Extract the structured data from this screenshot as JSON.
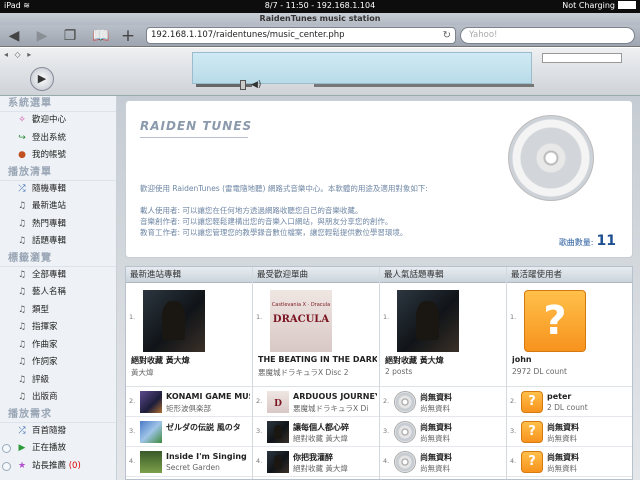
{
  "status_bar": {
    "device": "iPad",
    "wifi": "wifi-icon",
    "center": "8/7 - 11:50 - 192.168.1.104",
    "battery": "Not Charging"
  },
  "browser": {
    "title": "RaidenTunes music station",
    "url": "192.168.1.107/raidentunes/music_center.php",
    "search_placeholder": "Yahoo!"
  },
  "sidebar": {
    "sections": [
      {
        "heading": "系統選單",
        "items": [
          {
            "icon": "help-icon",
            "glyph": "✧",
            "color": "#d040a0",
            "label": "歡迎中心"
          },
          {
            "icon": "logout-icon",
            "glyph": "↪",
            "color": "#2a8a3a",
            "label": "登出系統"
          },
          {
            "icon": "account-icon",
            "glyph": "●",
            "color": "#c05020",
            "label": "我的帳號"
          }
        ]
      },
      {
        "heading": "播放清單",
        "items": [
          {
            "icon": "shuffle-icon",
            "glyph": "⤮",
            "color": "#3366aa",
            "label": "隨機專輯"
          },
          {
            "icon": "music-note-icon",
            "glyph": "♫",
            "color": "#555",
            "label": "最新進站"
          },
          {
            "icon": "music-note-icon",
            "glyph": "♫",
            "color": "#555",
            "label": "熱門專輯"
          },
          {
            "icon": "music-note-icon",
            "glyph": "♫",
            "color": "#555",
            "label": "話題專輯"
          }
        ]
      },
      {
        "heading": "標籤瀏覽",
        "items": [
          {
            "icon": "music-note-icon",
            "glyph": "♫",
            "color": "#555",
            "label": "全部專輯"
          },
          {
            "icon": "music-note-icon",
            "glyph": "♫",
            "color": "#555",
            "label": "藝人名稱"
          },
          {
            "icon": "music-note-icon",
            "glyph": "♫",
            "color": "#555",
            "label": "類型"
          },
          {
            "icon": "music-note-icon",
            "glyph": "♫",
            "color": "#555",
            "label": "指揮家"
          },
          {
            "icon": "music-note-icon",
            "glyph": "♫",
            "color": "#555",
            "label": "作曲家"
          },
          {
            "icon": "music-note-icon",
            "glyph": "♫",
            "color": "#555",
            "label": "作詞家"
          },
          {
            "icon": "music-note-icon",
            "glyph": "♫",
            "color": "#555",
            "label": "評級"
          },
          {
            "icon": "music-note-icon",
            "glyph": "♫",
            "color": "#555",
            "label": "出版商"
          }
        ]
      },
      {
        "heading": "播放需求",
        "items": [
          {
            "icon": "shuffle-icon",
            "glyph": "⤮",
            "color": "#3366aa",
            "label": "百首隨撥"
          },
          {
            "icon": "play-icon",
            "glyph": "▶",
            "color": "#2a9a3a",
            "label": "正在播放",
            "expand": true
          },
          {
            "icon": "star-icon",
            "glyph": "★",
            "color": "#b050d0",
            "label": "站長推薦",
            "count": "(0)",
            "expand": true
          }
        ]
      }
    ]
  },
  "hero": {
    "logo": "RAIDEN TUNES",
    "intro": "歡迎使用 RaidenTunes (雷電隨地聽) 網路式音樂中心。本軟體的用途及適用對象如下:",
    "roles": [
      "載人使用者: 可以讓您在任何地方透過網路收聽您自己的音樂收藏。",
      "音樂創作者: 可以讓您輕鬆建構出您的音樂入口網站，與朋友分享您的創作。",
      "教育工作者: 可以讓您管理您的教學錄音數位檔案，讓您輕鬆提供數位學習環境。"
    ],
    "song_count_label": "歌曲數量:",
    "song_count": "11"
  },
  "lists": [
    {
      "heading": "最新進站專輯",
      "featured": {
        "rank": "1.",
        "art": "photo",
        "title": "絕對收藏 黃大煒",
        "sub": "黃大煒"
      },
      "rows": [
        {
          "rank": "2.",
          "art": "game1",
          "title": "KONAMI GAME MUSI",
          "sub": "矩形波俱楽部"
        },
        {
          "rank": "3.",
          "art": "game2",
          "title": "ゼルダの伝説 風のタ",
          "sub": ""
        },
        {
          "rank": "4.",
          "art": "game3",
          "title": "Inside I'm Singing",
          "sub": "Secret Garden"
        }
      ]
    },
    {
      "heading": "最受歡迎單曲",
      "featured": {
        "rank": "1.",
        "art": "dracula",
        "art_sub": "Castlevania X · Dracula",
        "art_text": "DRACULA",
        "title": "THE BEATING IN THE DARKNE",
        "sub": "悪魔城ドラキュラX Disc 2"
      },
      "rows": [
        {
          "rank": "2.",
          "art": "dracula",
          "art_text": "D",
          "title": "ARDUOUS JOURNEY",
          "sub": "悪魔城ドラキュラX Di"
        },
        {
          "rank": "3.",
          "art": "photo",
          "title": "讓每個人都心碎",
          "sub": "絕對收藏 黃大煒"
        },
        {
          "rank": "4.",
          "art": "photo",
          "title": "你把我灌醉",
          "sub": "絕對收藏 黃大煒"
        }
      ]
    },
    {
      "heading": "最人氣話題專輯",
      "featured": {
        "rank": "1.",
        "art": "photo",
        "title": "絕對收藏 黃大煒",
        "sub": "2 posts"
      },
      "rows": [
        {
          "rank": "2.",
          "art": "disc",
          "title": "尚無資料",
          "sub": "尚無資料"
        },
        {
          "rank": "3.",
          "art": "disc",
          "title": "尚無資料",
          "sub": "尚無資料"
        },
        {
          "rank": "4.",
          "art": "disc",
          "title": "尚無資料",
          "sub": "尚無資料"
        }
      ]
    },
    {
      "heading": "最活躍使用者",
      "featured": {
        "rank": "1.",
        "art": "question",
        "art_text": "?",
        "title": "john",
        "sub": "2972 DL count"
      },
      "rows": [
        {
          "rank": "2.",
          "art": "question",
          "art_text": "?",
          "title": "peter",
          "sub": "2 DL count"
        },
        {
          "rank": "3.",
          "art": "question",
          "art_text": "?",
          "title": "尚無資料",
          "sub": "尚無資料"
        },
        {
          "rank": "4.",
          "art": "question",
          "art_text": "?",
          "title": "尚無資料",
          "sub": "尚無資料"
        }
      ]
    }
  ]
}
